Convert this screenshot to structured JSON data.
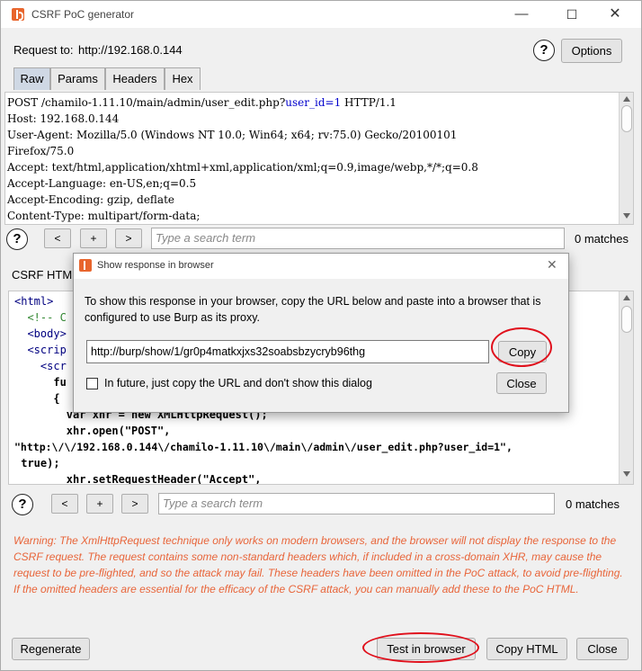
{
  "window": {
    "title": "CSRF PoC generator",
    "min_glyph": "—",
    "max_glyph": "☐",
    "close_glyph": "✕"
  },
  "request": {
    "label": "Request to:",
    "url": "http://192.168.0.144",
    "help_glyph": "?",
    "options_label": "Options"
  },
  "tabs": [
    "Raw",
    "Params",
    "Headers",
    "Hex"
  ],
  "request_lines": [
    {
      "before": "POST /chamilo-1.11.10/main/admin/user_edit.php?",
      "highlight": "user_id=1",
      "after": " HTTP/1.1"
    },
    {
      "before": "Host: 192.168.0.144",
      "highlight": "",
      "after": ""
    },
    {
      "before": "User-Agent: Mozilla/5.0 (Windows NT 10.0; Win64; x64; rv:75.0) Gecko/20100101",
      "highlight": "",
      "after": ""
    },
    {
      "before": "Firefox/75.0",
      "highlight": "",
      "after": ""
    },
    {
      "before": "Accept: text/html,application/xhtml+xml,application/xml;q=0.9,image/webp,*/*;q=0.8",
      "highlight": "",
      "after": ""
    },
    {
      "before": "Accept-Language: en-US,en;q=0.5",
      "highlight": "",
      "after": ""
    },
    {
      "before": "Accept-Encoding: gzip, deflate",
      "highlight": "",
      "after": ""
    },
    {
      "before": "Content-Type: multipart/form-data;",
      "highlight": "",
      "after": ""
    }
  ],
  "search_top": {
    "help": "?",
    "prev": "<",
    "add": "+",
    "next": ">",
    "placeholder": "Type a search term",
    "matches": "0 matches"
  },
  "csrf_label": "CSRF HTML:",
  "code_lines": [
    {
      "text": "<html>",
      "kind": "tag"
    },
    {
      "text": "  <!-- C",
      "kind": "comment"
    },
    {
      "text": "  <body>",
      "kind": "tag"
    },
    {
      "text": "  <scrip",
      "kind": "tag"
    },
    {
      "text": "    <scr",
      "kind": "tag"
    },
    {
      "text": "      fu",
      "kind": "bold"
    },
    {
      "text": "      {",
      "kind": "bold"
    },
    {
      "text": "        var xhr = new XMLHttpRequest();",
      "kind": "bold"
    },
    {
      "text": "        xhr.open(\"POST\",",
      "kind": "bold"
    },
    {
      "text": "\"http:\\/\\/192.168.0.144\\/chamilo-1.11.10\\/main\\/admin\\/user_edit.php?user_id=1\",",
      "kind": "bold"
    },
    {
      "text": " true);",
      "kind": "bold"
    },
    {
      "text": "        xhr.setRequestHeader(\"Accept\",",
      "kind": "bold"
    }
  ],
  "search_bottom": {
    "help": "?",
    "prev": "<",
    "add": "+",
    "next": ">",
    "placeholder": "Type a search term",
    "matches": "0 matches"
  },
  "warning": "Warning: The XmlHttpRequest technique only works on modern browsers, and the browser will not display the response to the CSRF request. The request contains some non-standard headers which, if included in a cross-domain XHR, may cause the request to be pre-flighted, and so the attack may fail. These headers have been omitted in the PoC attack, to avoid pre-flighting. If the omitted headers are essential for the efficacy of the CSRF attack, you can manually add these to the PoC HTML.",
  "footer": {
    "regenerate": "Regenerate",
    "test_in_browser": "Test in browser",
    "copy_html": "Copy HTML",
    "close": "Close"
  },
  "dialog": {
    "title": "Show response in browser",
    "close_glyph": "✕",
    "message": "To show this response in your browser, copy the URL below and paste into a browser that is configured to use Burp as its proxy.",
    "url": "http://burp/show/1/gr0p4matkxjxs32soabsbzycryb96thg",
    "copy_label": "Copy",
    "checkbox_label": "In future, just copy the URL and don't show this dialog",
    "checkbox_checked": false,
    "close_label": "Close"
  },
  "colors": {
    "warning": "#e8653a",
    "annotation": "#e0101c",
    "burp_orange": "#e8652d"
  }
}
